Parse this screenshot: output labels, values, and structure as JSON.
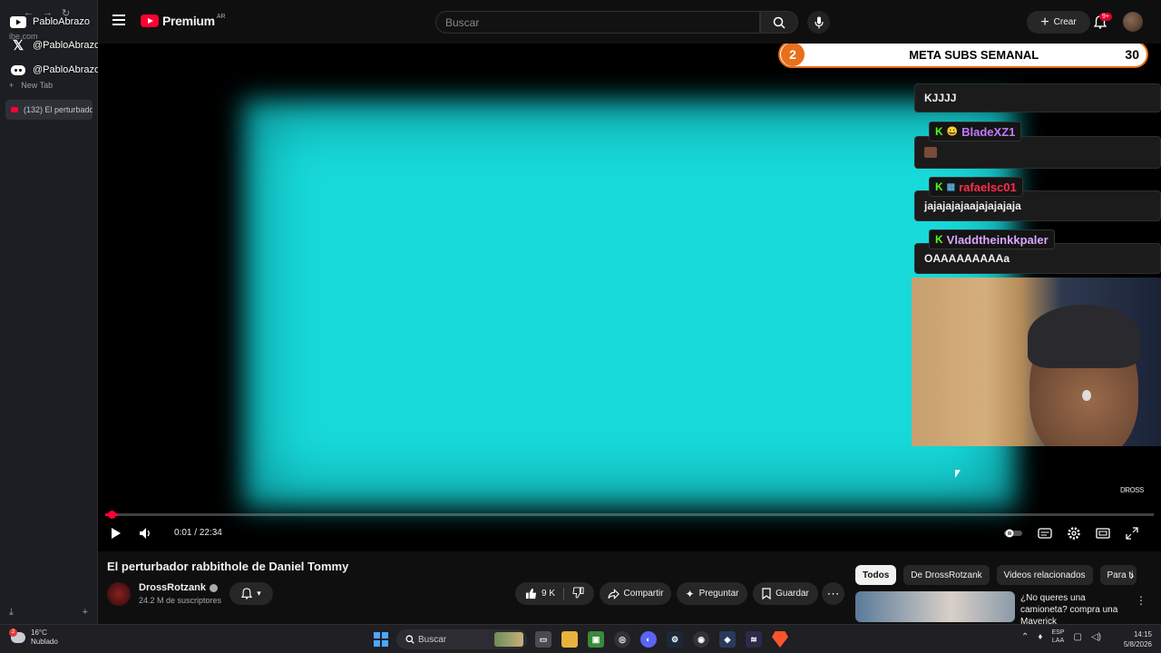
{
  "browser_sidebar": {
    "url_fragment": "ibe.com",
    "new_tab_label": "New Tab",
    "active_tab_label": "(132) El perturbado",
    "overlays": [
      {
        "platform": "youtube",
        "handle": "PabloAbrazo"
      },
      {
        "platform": "x",
        "handle": "@PabloAbrazo_"
      },
      {
        "platform": "discord",
        "handle": "@PabloAbrazo_"
      }
    ]
  },
  "header": {
    "logo_text": "Premium",
    "country_code": "AR",
    "search_placeholder": "Buscar",
    "create_label": "Crear",
    "notifications_badge": "9+"
  },
  "stream_overlay": {
    "goal_current": "2",
    "goal_label": "META SUBS SEMANAL",
    "goal_target": "30",
    "chat": [
      {
        "user": "",
        "message": "KJJJJ",
        "user_color": "#ffffff"
      },
      {
        "user": "BladeXZ1",
        "message": "",
        "user_color": "#c07aff"
      },
      {
        "user": "rafaelsc01",
        "message": "jajajajajaajajajajaja",
        "user_color": "#ff2e4e"
      },
      {
        "user": "Vladdtheinkkpaler",
        "message": "OAAAAAAAAAa",
        "user_color": "#d9a6ff"
      }
    ],
    "watermark": "DROSS"
  },
  "player": {
    "time_current": "0:01",
    "time_separator": "/",
    "time_total": "22:34",
    "progress_fraction": 0.0007
  },
  "video": {
    "title": "El perturbador rabbithole de Daniel Tommy",
    "channel_name": "DrossRotzank",
    "subscribers": "24.2 M de suscriptores",
    "likes": "9 K",
    "share_label": "Compartir",
    "ask_label": "Preguntar",
    "save_label": "Guardar"
  },
  "related": {
    "chips": [
      "Todos",
      "De DrossRotzank",
      "Videos relacionados",
      "Para ti"
    ],
    "first_title": "¿No queres una camioneta? compra una Maverick"
  },
  "taskbar": {
    "weather_temp": "16°C",
    "weather_desc": "Nublado",
    "weather_badge": "2",
    "search_label": "Buscar",
    "lang_top": "ESP",
    "lang_bottom": "LAA",
    "time": "14:15",
    "date": "5/8/2026"
  },
  "colors": {
    "accent_red": "#ff0033",
    "overlay_orange": "#e8701c",
    "kick_green": "#53fc18",
    "video_cyan": "#18dada"
  }
}
